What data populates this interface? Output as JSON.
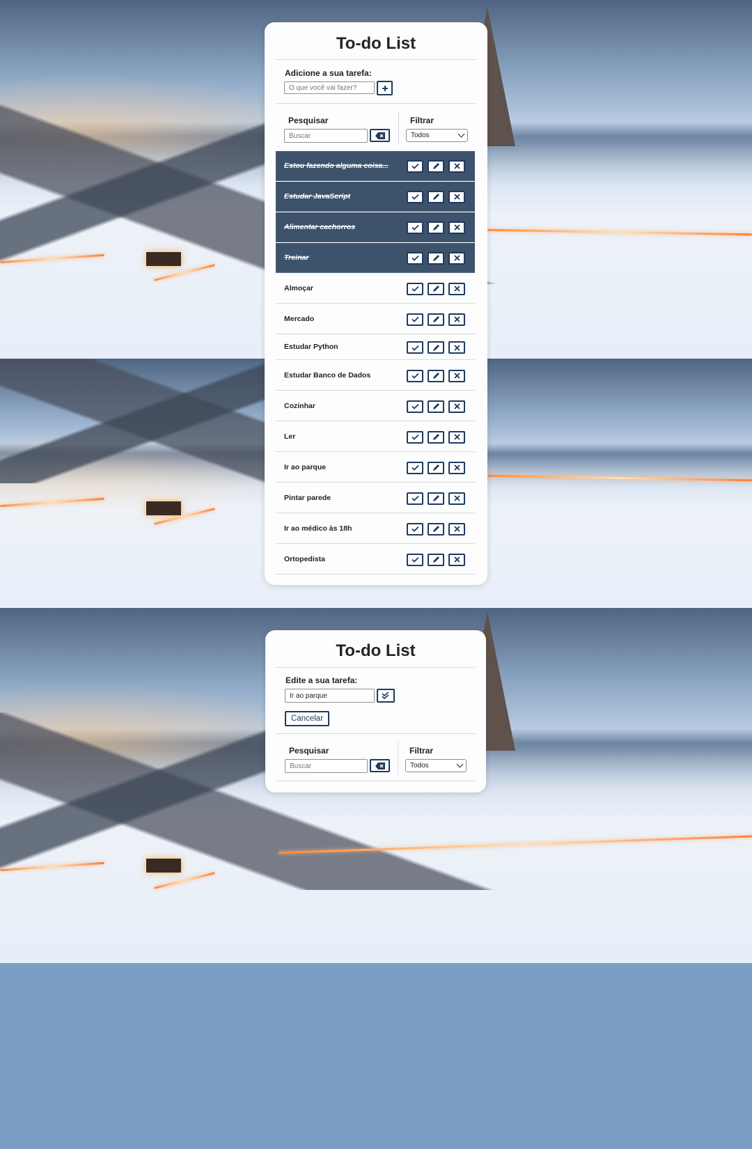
{
  "app": {
    "title": "To-do List"
  },
  "add_panel": {
    "label": "Adicione a sua tarefa:",
    "placeholder": "O que você vai fazer?",
    "add_icon": "plus-icon"
  },
  "search": {
    "label": "Pesquisar",
    "placeholder": "Buscar",
    "clear_icon": "backspace-icon"
  },
  "filter": {
    "label": "Filtrar",
    "selected": "Todos"
  },
  "tasks": [
    {
      "text": "Estou fazendo alguma coisa...",
      "done": true
    },
    {
      "text": "Estudar JavaScript",
      "done": true
    },
    {
      "text": "Alimentar cachorros",
      "done": true
    },
    {
      "text": "Treinar",
      "done": true
    },
    {
      "text": "Almoçar",
      "done": false
    },
    {
      "text": "Mercado",
      "done": false
    },
    {
      "text": "Estudar Python",
      "done": false
    },
    {
      "text": "Estudar Banco de Dados",
      "done": false
    },
    {
      "text": "Cozinhar",
      "done": false
    },
    {
      "text": "Ler",
      "done": false
    },
    {
      "text": "Ir ao parque",
      "done": false
    },
    {
      "text": "Pintar parede",
      "done": false
    },
    {
      "text": "Ir ao médico às 18h",
      "done": false
    },
    {
      "text": "Ortopedista",
      "done": false
    }
  ],
  "task_actions": {
    "finish_icon": "check-icon",
    "edit_icon": "pencil-icon",
    "remove_icon": "close-icon"
  },
  "edit_panel": {
    "title": "To-do List",
    "label": "Edite a sua tarefa:",
    "value": "Ir ao parque",
    "confirm_icon": "double-check-icon",
    "cancel_label": "Cancelar",
    "search_label": "Pesquisar",
    "search_placeholder": "Buscar",
    "filter_label": "Filtrar",
    "filter_selected": "Todos"
  }
}
